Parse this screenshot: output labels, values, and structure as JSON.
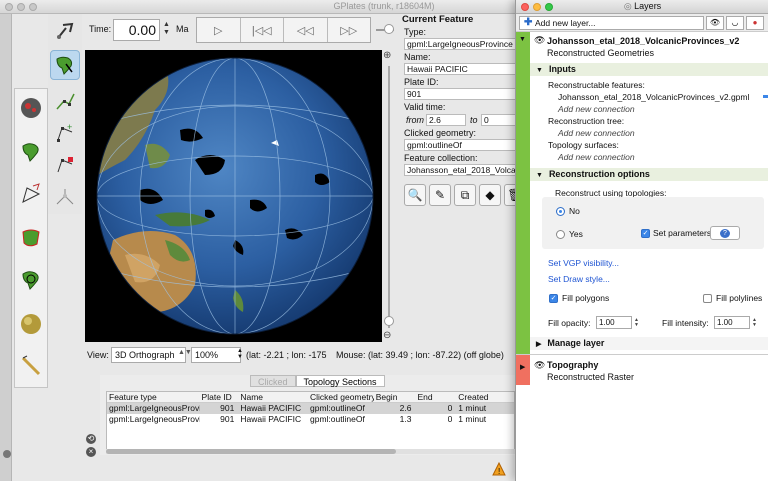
{
  "main_window": {
    "title": "GPlates (trunk, r18604M)"
  },
  "time_bar": {
    "label": "Time:",
    "value": "0.00",
    "unit": "Ma"
  },
  "view_bar": {
    "label": "View:",
    "projection": "3D Orthograph",
    "zoom": "100%",
    "camera_coords": "(lat: -2.21 ; lon: -175",
    "mouse_coords": "Mouse: (lat: 39.49 ; lon: -87.22) (off globe)"
  },
  "current_feature": {
    "heading": "Current Feature",
    "type_label": "Type:",
    "type_value": "gpml:LargeIgneousProvince",
    "name_label": "Name:",
    "name_value": "Hawaii PACIFIC",
    "plate_label": "Plate ID:",
    "plate_value": "901",
    "valid_label": "Valid time:",
    "from_label": "from",
    "from_value": "2.6",
    "to_label": "to",
    "to_value": "0",
    "geom_label": "Clicked geometry:",
    "geom_value": "gpml:outlineOf",
    "collection_label": "Feature collection:",
    "collection_value": "Johansson_etal_2018_VolcanicProvinces_v2.gpml"
  },
  "table": {
    "tabs": [
      "Clicked",
      "Topology Sections"
    ],
    "active_tab": 1,
    "headers": [
      "Feature type",
      "Plate ID",
      "Name",
      "Clicked geometry",
      "Begin",
      "End",
      "Created"
    ],
    "rows": [
      [
        "gpml:LargeIgneousProvince",
        "901",
        "Hawaii PACIFIC",
        "gpml:outlineOf",
        "2.6",
        "0",
        "1 minut"
      ],
      [
        "gpml:LargeIgneousProvince",
        "901",
        "Hawaii PACIFIC",
        "gpml:outlineOf",
        "1.3",
        "0",
        "1 minut"
      ]
    ]
  },
  "layers_window": {
    "title": "Layers",
    "add_layer": "Add new layer...",
    "layer1": {
      "name": "Johansson_etal_2018_VolcanicProvinces_v2",
      "type": "Reconstructed Geometries",
      "color": "#7cc242",
      "inputs_heading": "Inputs",
      "reconstructable_label": "Reconstructable features:",
      "reconstructable_file": "Johansson_etal_2018_VolcanicProvinces_v2.gpml",
      "add_connection": "Add new connection",
      "tree_label": "Reconstruction tree:",
      "tree_link": "Add new connection",
      "topo_label": "Topology surfaces:",
      "topo_link": "Add new connection",
      "options_heading": "Reconstruction options",
      "reconstruct_using": "Reconstruct using topologies:",
      "opt_no": "No",
      "opt_yes": "Yes",
      "set_params": "Set parameters",
      "params_btn": "?",
      "vgp_link": "Set VGP visibility...",
      "draw_link": "Set Draw style...",
      "fill_polygons": "Fill polygons",
      "fill_polylines": "Fill polylines",
      "fill_opacity_label": "Fill opacity:",
      "fill_opacity": "1.00",
      "fill_intensity_label": "Fill intensity:",
      "fill_intensity": "1.00",
      "manage_heading": "Manage layer"
    },
    "layer2": {
      "name": "Topography",
      "type": "Reconstructed Raster",
      "color": "#f07060"
    }
  }
}
